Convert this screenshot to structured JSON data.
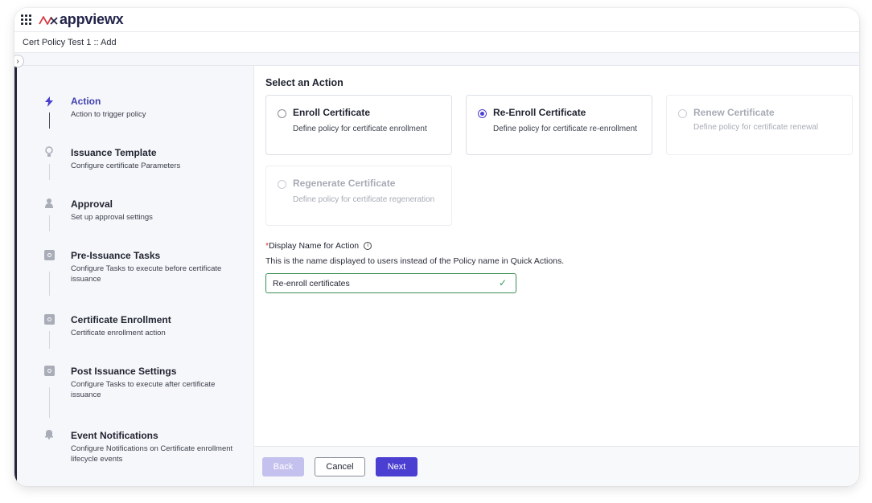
{
  "app": {
    "logo_text": "appviewx",
    "breadcrumb": "Cert Policy Test 1 :: Add"
  },
  "sidebar": {
    "steps": [
      {
        "title": "Action",
        "desc": "Action to trigger policy",
        "icon": "bolt-icon",
        "active": true
      },
      {
        "title": "Issuance Template",
        "desc": "Configure certificate Parameters",
        "icon": "bulb-icon"
      },
      {
        "title": "Approval",
        "desc": "Set up approval settings",
        "icon": "user-icon"
      },
      {
        "title": "Pre-Issuance Tasks",
        "desc": "Configure Tasks to execute before certificate issuance",
        "icon": "gear-icon"
      },
      {
        "title": "Certificate Enrollment",
        "desc": "Certificate enrollment action",
        "icon": "gear-icon"
      },
      {
        "title": "Post Issuance Settings",
        "desc": "Configure Tasks to execute after certificate issuance",
        "icon": "gear-icon"
      },
      {
        "title": "Event Notifications",
        "desc": "Configure Notifications on Certificate enrollment lifecycle events",
        "icon": "bell-icon"
      }
    ]
  },
  "main": {
    "section_title": "Select an Action",
    "actions": [
      {
        "title": "Enroll Certificate",
        "desc": "Define policy for certificate enrollment",
        "selected": false,
        "disabled": false
      },
      {
        "title": "Re-Enroll Certificate",
        "desc": "Define policy for certificate re-enrollment",
        "selected": true,
        "disabled": false
      },
      {
        "title": "Renew Certificate",
        "desc": "Define policy for certificate renewal",
        "selected": false,
        "disabled": true
      },
      {
        "title": "Regenerate Certificate",
        "desc": "Define policy for certificate regeneration",
        "selected": false,
        "disabled": true
      }
    ],
    "display_name": {
      "required_mark": "*",
      "label": "Display Name for Action",
      "help": "This is the name displayed to users instead of the Policy name in Quick Actions.",
      "value": "Re-enroll certificates"
    }
  },
  "footer": {
    "back_label": "Back",
    "cancel_label": "Cancel",
    "next_label": "Next"
  },
  "colors": {
    "accent": "#4a3fd0",
    "success": "#3a9a5a",
    "required": "#d23c3c"
  }
}
